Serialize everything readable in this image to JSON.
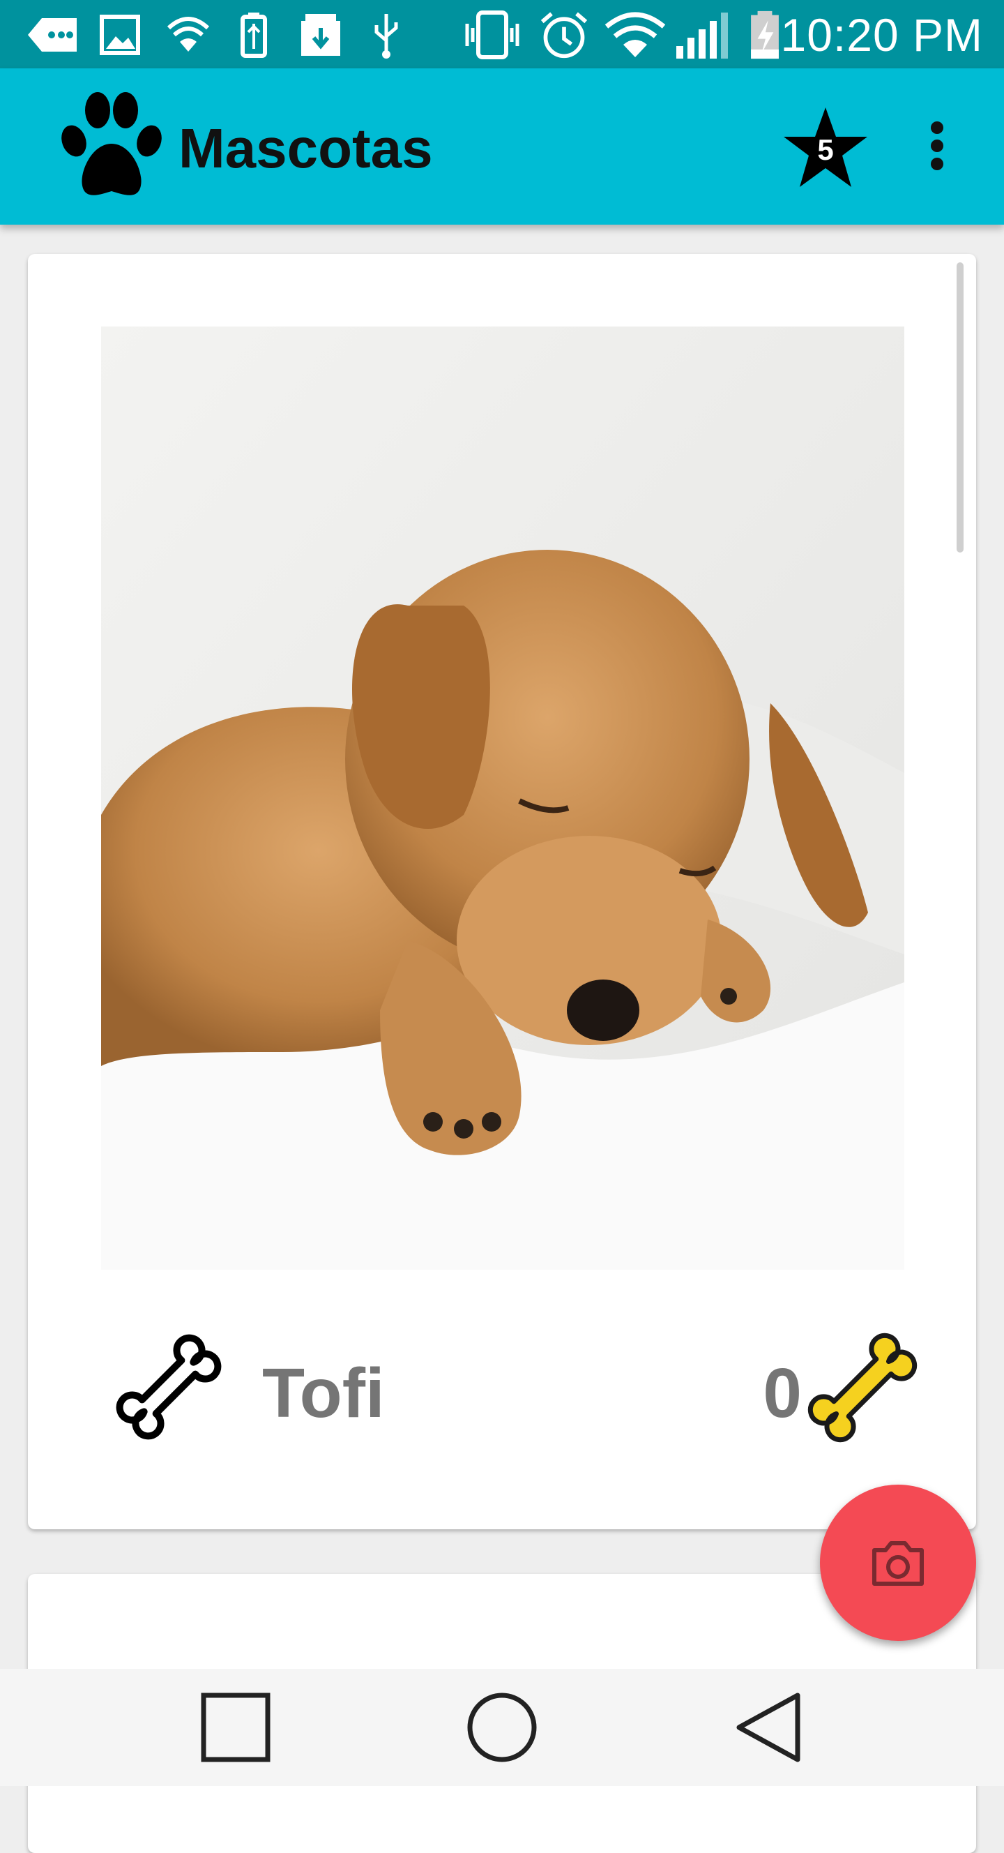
{
  "status_bar": {
    "time": "10:20 PM",
    "icons": [
      "message-icon",
      "image-icon",
      "wifi-secure-icon",
      "usb-battery-icon",
      "download-icon",
      "usb-icon",
      "vibrate-icon",
      "alarm-icon",
      "wifi-icon",
      "signal-icon",
      "battery-charging-icon"
    ]
  },
  "app_bar": {
    "title": "Mascotas",
    "logo_icon": "paw-icon",
    "favorites_count": "5",
    "favorites_icon": "star-icon",
    "menu_icon": "more-vert-icon"
  },
  "pets": [
    {
      "name": "Tofi",
      "likes": "0",
      "photo_icon": "sleeping-puppy-photo",
      "bone_icon": "bone-icon",
      "rate_icon": "bone-filled-icon"
    }
  ],
  "fab": {
    "icon": "camera-icon"
  },
  "nav_bar": {
    "icons": [
      "recents-icon",
      "home-icon",
      "back-icon"
    ]
  },
  "colors": {
    "status_bar": "#00929e",
    "app_bar": "#00bcd4",
    "fab": "#f44a54",
    "bone_gold": "#f5d11f",
    "text_gray": "#757575"
  }
}
